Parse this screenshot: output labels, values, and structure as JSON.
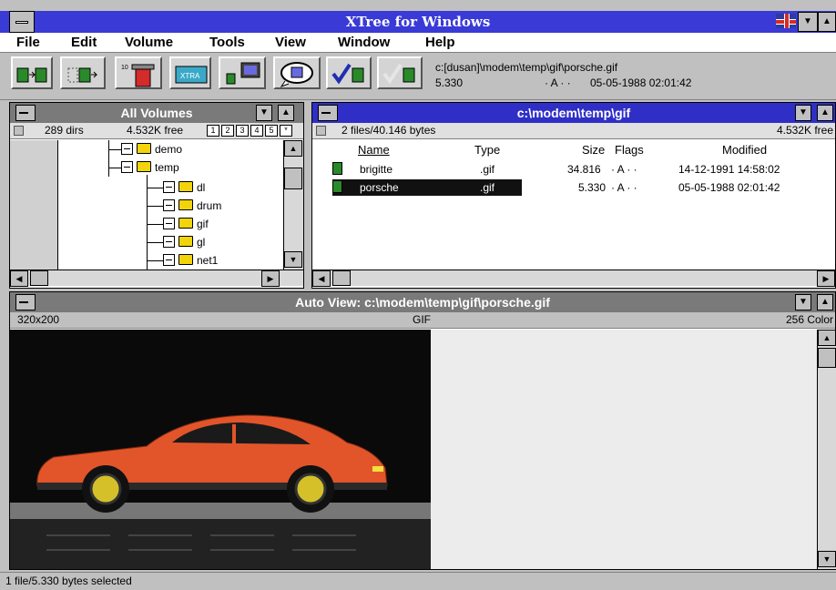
{
  "app": {
    "title": "XTree for Windows"
  },
  "menu": [
    "File",
    "Edit",
    "Volume",
    "Tools",
    "View",
    "Window",
    "Help"
  ],
  "toolbar": {
    "path": "c:[dusan]\\modem\\temp\\gif\\porsche.gif",
    "size": "5.330",
    "attr": "· A · ·",
    "datetime": "05-05-1988 02:01:42",
    "buttons": [
      "copy-file-icon",
      "move-file-icon",
      "delete-file-icon",
      "xtra-icon",
      "compare-icon",
      "view-icon",
      "tag-icon",
      "untag-icon"
    ],
    "xtra_label": "XTRA"
  },
  "volumes": {
    "title": "All Volumes",
    "dirs": "289 dirs",
    "free": "4.532K free",
    "drive_tabs": [
      "1",
      "2",
      "3",
      "4",
      "5",
      "*"
    ],
    "tree": [
      "demo",
      "temp",
      "dl",
      "drum",
      "gif",
      "gl",
      "net1"
    ]
  },
  "files": {
    "title": "c:\\modem\\temp\\gif",
    "summary": "2 files/40.146 bytes",
    "free": "4.532K free",
    "columns": [
      "Name",
      "Type",
      "Size",
      "Flags",
      "Modified"
    ],
    "rows": [
      {
        "name": "brigitte",
        "type": ".gif",
        "size": "34.816",
        "flags": "· A · ·",
        "modified": "14-12-1991  14:58:02"
      },
      {
        "name": "porsche",
        "type": ".gif",
        "size": "5.330",
        "flags": "· A · ·",
        "modified": "05-05-1988  02:01:42"
      }
    ]
  },
  "autoview": {
    "title": "Auto View: c:\\modem\\temp\\gif\\porsche.gif",
    "resolution": "320x200",
    "format": "GIF",
    "colors": "256 Color"
  },
  "status": {
    "text": "1 file/5.330 bytes selected"
  },
  "colors": {
    "titlebar": "#3a3ad6",
    "active_title": "#2f2fc8",
    "inactive_title": "#7a7a7a",
    "car": "#e2552a"
  }
}
